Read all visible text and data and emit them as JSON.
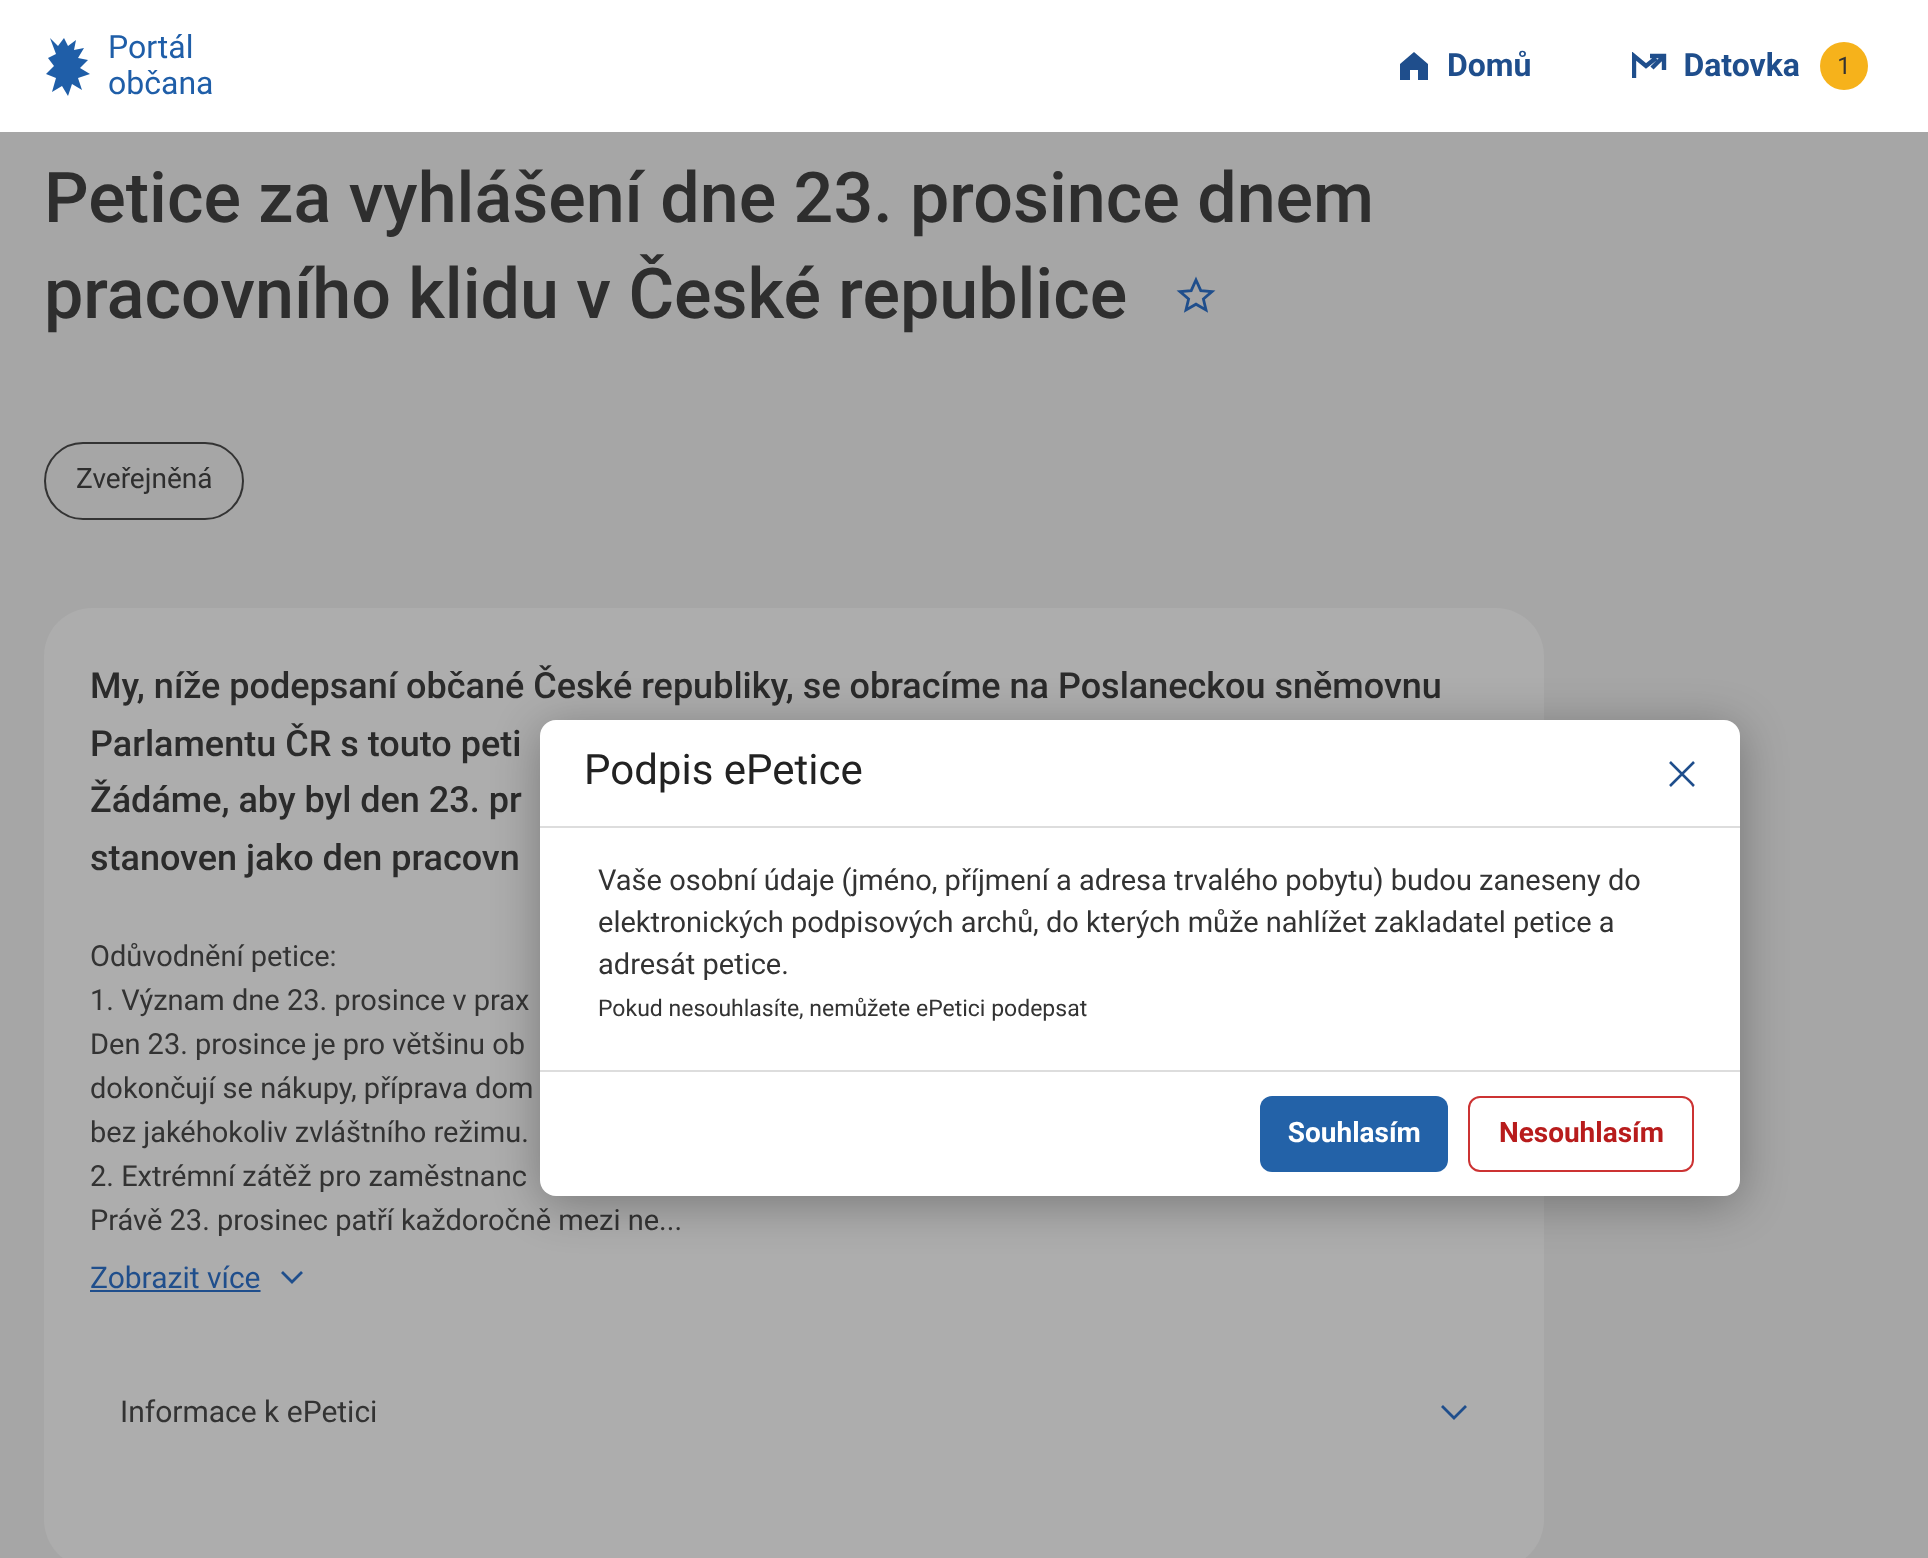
{
  "header": {
    "logo_lines": [
      "Portál",
      "občana"
    ],
    "nav": [
      {
        "kind": "home",
        "label": "Domů"
      },
      {
        "kind": "mail",
        "label": "Datovka",
        "badge": "1"
      }
    ]
  },
  "petition": {
    "title_lines": [
      "Petice za vyhlášení dne 23. prosince dnem",
      "pracovního klidu v České republice"
    ],
    "favorite": false,
    "status": "Zveřejněná",
    "card": {
      "intro_lines": [
        "My, níže podepsaní občané České republiky, se obracíme na Poslaneckou sněmovnu",
        "Parlamentu ČR s touto peti",
        "Žádáme, aby byl den 23. pr",
        "stanoven jako den pracovn"
      ],
      "reason_lines": [
        "Odůvodnění petice:",
        "1. Význam dne 23. prosince v prax",
        "Den 23. prosince je pro většinu ob",
        "dokončují se nákupy, příprava dom",
        "bez jakéhokoliv zvláštního režimu.",
        "2. Extrémní zátěž pro zaměstnanc",
        "Právě 23. prosinec patří každoročně mezi ne..."
      ],
      "show_more": "Zobrazit více",
      "accordion": {
        "label": "Informace k ePetici",
        "expanded": false
      }
    }
  },
  "modal": {
    "title": "Podpis ePetice",
    "body": "Vaše osobní údaje (jméno, příjmení a adresa trvalého pobytu) budou zaneseny do elektronických podpisových archů, do kterých může nahlížet zakladatel petice a adresát petice.",
    "note": "Pokud nesouhlasíte, nemůžete ePetici podepsat",
    "buttons": [
      {
        "kind": "primary",
        "label": "Souhlasím"
      },
      {
        "kind": "danger",
        "label": "Nesouhlasím"
      }
    ]
  }
}
